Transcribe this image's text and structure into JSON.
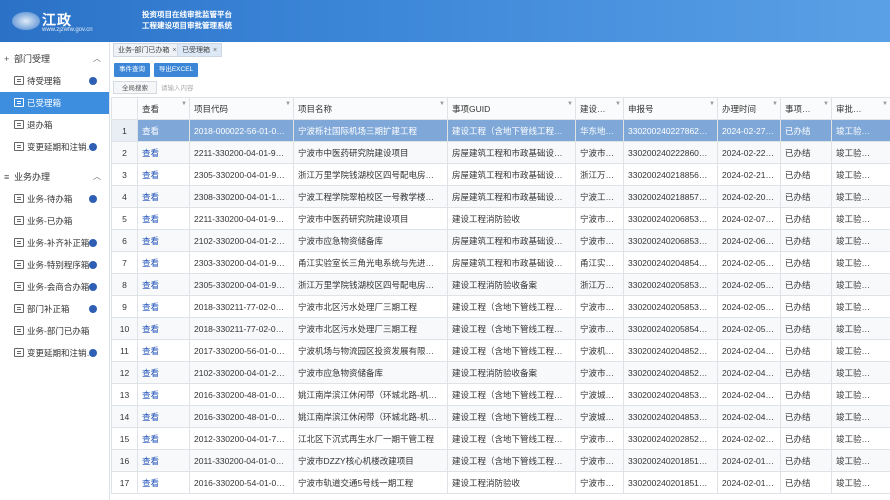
{
  "header": {
    "logo_text": "江政",
    "logo_url": "www.zjzwfw.gov.cn",
    "title_line1": "投资项目在线审批监管平台",
    "title_line2": "工程建设项目审批管理系统"
  },
  "sidebar": {
    "groups": [
      {
        "label": "部门受理",
        "items": [
          {
            "label": "待受理箱",
            "badge": true,
            "active": false
          },
          {
            "label": "已受理箱",
            "badge": false,
            "active": true
          },
          {
            "label": "退办箱",
            "badge": false,
            "active": false
          },
          {
            "label": "变更延期和注销…",
            "badge": true,
            "active": false
          }
        ]
      },
      {
        "label": "业务办理",
        "items": [
          {
            "label": "业务-待办箱",
            "badge": true,
            "active": false
          },
          {
            "label": "业务-已办箱",
            "badge": false,
            "active": false
          },
          {
            "label": "业务-补齐补正箱",
            "badge": true,
            "active": false
          },
          {
            "label": "业务-特别程序箱",
            "badge": true,
            "active": false
          },
          {
            "label": "业务-会商合办箱",
            "badge": true,
            "active": false
          },
          {
            "label": "部门补正箱",
            "badge": true,
            "active": false
          },
          {
            "label": "业务-部门已办箱",
            "badge": false,
            "active": false
          },
          {
            "label": "变更延期和注销…",
            "badge": true,
            "active": false
          }
        ]
      }
    ]
  },
  "tabs": [
    {
      "label": "业务-部门已办箱",
      "active": false
    },
    {
      "label": "已受理箱",
      "active": true
    }
  ],
  "toolbar": {
    "event_query_label": "事件查询",
    "export_label": "导出EXCEL"
  },
  "search": {
    "button_label": "全局搜索",
    "placeholder": "请输入内容"
  },
  "table": {
    "columns": [
      "",
      "查看",
      "项目代码",
      "项目名称",
      "事项GUID",
      "建设…",
      "申报号",
      "办理时间",
      "事项…",
      "审批…"
    ],
    "rows": [
      {
        "n": "1",
        "view": "查看",
        "code": "2018-000022-56-01-0…",
        "name": "宁波栎社国际机场三期扩建工程",
        "guid": "建设工程（含地下管线工程…",
        "builder": "华东地…",
        "decl": "330200240227862…",
        "time": "2024-02-27…",
        "status": "已办结",
        "approval": "竣工验…",
        "selected": true
      },
      {
        "n": "2",
        "view": "查看",
        "code": "2211-330200-04-01-9…",
        "name": "宁波市中医药研究院建设项目",
        "guid": "房屋建筑工程和市政基础设…",
        "builder": "宁波市…",
        "decl": "330200240222860…",
        "time": "2024-02-22…",
        "status": "已办结",
        "approval": "竣工验…",
        "selected": false
      },
      {
        "n": "3",
        "view": "查看",
        "code": "2305-330200-04-01-9…",
        "name": "浙江万里学院钱湖校区四号配电房…",
        "guid": "房屋建筑工程和市政基础设…",
        "builder": "浙江万…",
        "decl": "330200240218856…",
        "time": "2024-02-21…",
        "status": "已办结",
        "approval": "竣工验…",
        "selected": false
      },
      {
        "n": "4",
        "view": "查看",
        "code": "2308-330200-04-01-1…",
        "name": "宁波工程学院翠柏校区一号教学楼…",
        "guid": "房屋建筑工程和市政基础设…",
        "builder": "宁波工…",
        "decl": "330200240218857…",
        "time": "2024-02-20…",
        "status": "已办结",
        "approval": "竣工验…",
        "selected": false
      },
      {
        "n": "5",
        "view": "查看",
        "code": "2211-330200-04-01-9…",
        "name": "宁波市中医药研究院建设项目",
        "guid": "建设工程消防验收",
        "builder": "宁波市…",
        "decl": "330200240206853…",
        "time": "2024-02-07…",
        "status": "已办结",
        "approval": "竣工验…",
        "selected": false
      },
      {
        "n": "6",
        "view": "查看",
        "code": "2102-330200-04-01-2…",
        "name": "宁波市应急物资储备库",
        "guid": "房屋建筑工程和市政基础设…",
        "builder": "宁波市…",
        "decl": "330200240206853…",
        "time": "2024-02-06…",
        "status": "已办结",
        "approval": "竣工验…",
        "selected": false
      },
      {
        "n": "7",
        "view": "查看",
        "code": "2303-330200-04-01-9…",
        "name": "甬江实验室长三角光电系统与先进…",
        "guid": "房屋建筑工程和市政基础设…",
        "builder": "甬江实验室",
        "decl": "330200240204854…",
        "time": "2024-02-05…",
        "status": "已办结",
        "approval": "竣工验…",
        "selected": false
      },
      {
        "n": "8",
        "view": "查看",
        "code": "2305-330200-04-01-9…",
        "name": "浙江万里学院钱湖校区四号配电房…",
        "guid": "建设工程消防验收备案",
        "builder": "浙江万…",
        "decl": "330200240205853…",
        "time": "2024-02-05…",
        "status": "已办结",
        "approval": "竣工验…",
        "selected": false
      },
      {
        "n": "9",
        "view": "查看",
        "code": "2018-330211-77-02-0…",
        "name": "宁波市北区污水处理厂三期工程",
        "guid": "建设工程（含地下管线工程…",
        "builder": "宁波市…",
        "decl": "330200240205853…",
        "time": "2024-02-05…",
        "status": "已办结",
        "approval": "竣工验…",
        "selected": false
      },
      {
        "n": "10",
        "view": "查看",
        "code": "2018-330211-77-02-0…",
        "name": "宁波市北区污水处理厂三期工程",
        "guid": "建设工程（含地下管线工程…",
        "builder": "宁波市…",
        "decl": "330200240205854…",
        "time": "2024-02-05…",
        "status": "已办结",
        "approval": "竣工验…",
        "selected": false
      },
      {
        "n": "11",
        "view": "查看",
        "code": "2017-330200-56-01-0…",
        "name": "宁波机场与物流园区投资发展有限…",
        "guid": "建设工程（含地下管线工程…",
        "builder": "宁波机…",
        "decl": "330200240204852…",
        "time": "2024-02-04…",
        "status": "已办结",
        "approval": "竣工验…",
        "selected": false
      },
      {
        "n": "12",
        "view": "查看",
        "code": "2102-330200-04-01-2…",
        "name": "宁波市应急物资储备库",
        "guid": "建设工程消防验收备案",
        "builder": "宁波市…",
        "decl": "330200240204852…",
        "time": "2024-02-04…",
        "status": "已办结",
        "approval": "竣工验…",
        "selected": false
      },
      {
        "n": "13",
        "view": "查看",
        "code": "2016-330200-48-01-0…",
        "name": "姚江南岸滨江休闲带（环城北路-机…",
        "guid": "建设工程（含地下管线工程…",
        "builder": "宁波城…",
        "decl": "330200240204853…",
        "time": "2024-02-04…",
        "status": "已办结",
        "approval": "竣工验…",
        "selected": false
      },
      {
        "n": "14",
        "view": "查看",
        "code": "2016-330200-48-01-0…",
        "name": "姚江南岸滨江休闲带（环城北路-机…",
        "guid": "建设工程（含地下管线工程…",
        "builder": "宁波城…",
        "decl": "330200240204853…",
        "time": "2024-02-04…",
        "status": "已办结",
        "approval": "竣工验…",
        "selected": false
      },
      {
        "n": "15",
        "view": "查看",
        "code": "2012-330200-04-01-7…",
        "name": "江北区下沉式再生水厂一期干管工程",
        "guid": "建设工程（含地下管线工程…",
        "builder": "宁波市…",
        "decl": "330200240202852…",
        "time": "2024-02-02…",
        "status": "已办结",
        "approval": "竣工验…",
        "selected": false
      },
      {
        "n": "16",
        "view": "查看",
        "code": "2011-330200-04-01-0…",
        "name": "宁波市DZZY核心机楼改建项目",
        "guid": "建设工程（含地下管线工程…",
        "builder": "宁波市…",
        "decl": "330200240201851…",
        "time": "2024-02-01…",
        "status": "已办结",
        "approval": "竣工验…",
        "selected": false
      },
      {
        "n": "17",
        "view": "查看",
        "code": "2016-330200-54-01-0…",
        "name": "宁波市轨道交通5号线一期工程",
        "guid": "建设工程消防验收",
        "builder": "宁波市…",
        "decl": "330200240201851…",
        "time": "2024-02-01…",
        "status": "已办结",
        "approval": "竣工验…",
        "selected": false
      }
    ]
  },
  "colors": {
    "header_start": "#2b72c7",
    "accent": "#3e8ee0",
    "selected_row": "#7fa8d8",
    "link": "#1d4fb8",
    "badge": "#2e5fb5"
  },
  "icons": {
    "group": "menu-group-icon",
    "item": "document-icon",
    "collapse": "chevron-up-icon",
    "sort": "sort-icon",
    "close": "close-icon"
  }
}
